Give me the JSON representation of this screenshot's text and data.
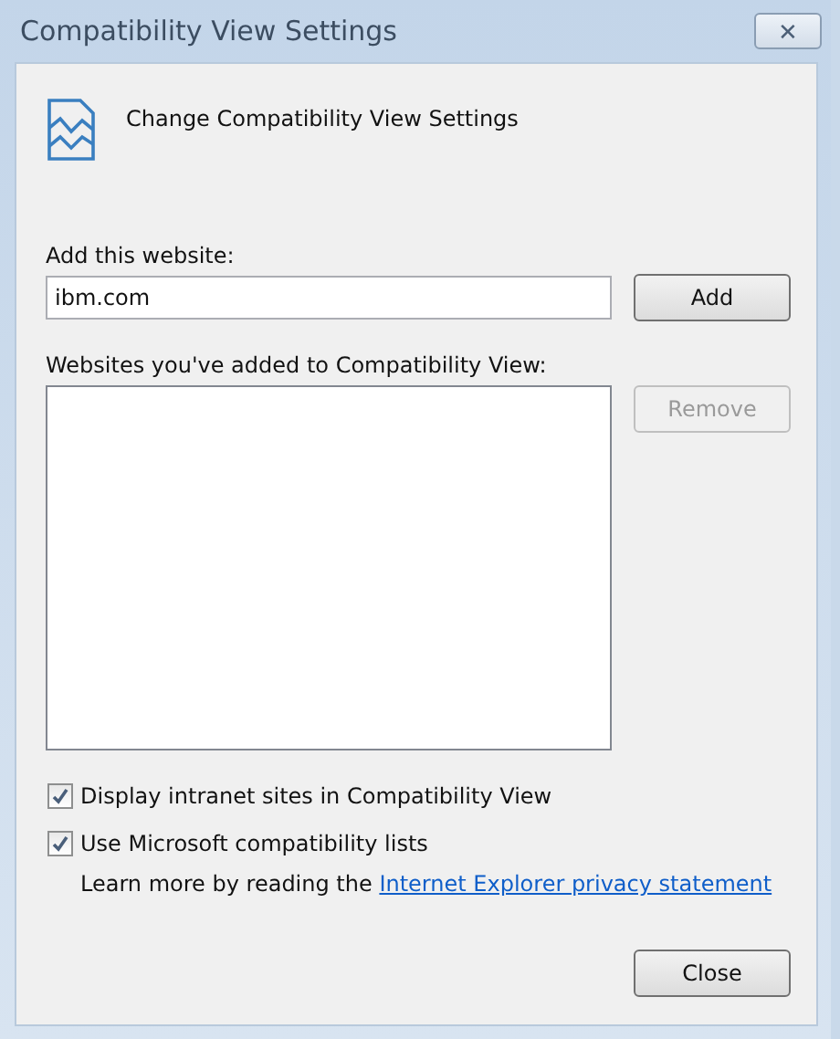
{
  "window": {
    "title": "Compatibility View Settings",
    "close_glyph": "✕"
  },
  "heading": "Change Compatibility View Settings",
  "add_website": {
    "label": "Add this website:",
    "value": "ibm.com",
    "button": {
      "label": "Add",
      "disabled": false
    }
  },
  "websites": {
    "label": "Websites you've added to Compatibility View:",
    "remove_button": {
      "label": "Remove",
      "disabled": true
    }
  },
  "options": [
    {
      "label": "Display intranet sites in Compatibility View",
      "checked": true
    },
    {
      "label": "Use Microsoft compatibility lists",
      "checked": true
    }
  ],
  "privacy": {
    "text": "Learn more by reading the",
    "link": "Internet Explorer privacy statement"
  },
  "buttons": [
    {
      "label": "Close",
      "disabled": false
    }
  ]
}
